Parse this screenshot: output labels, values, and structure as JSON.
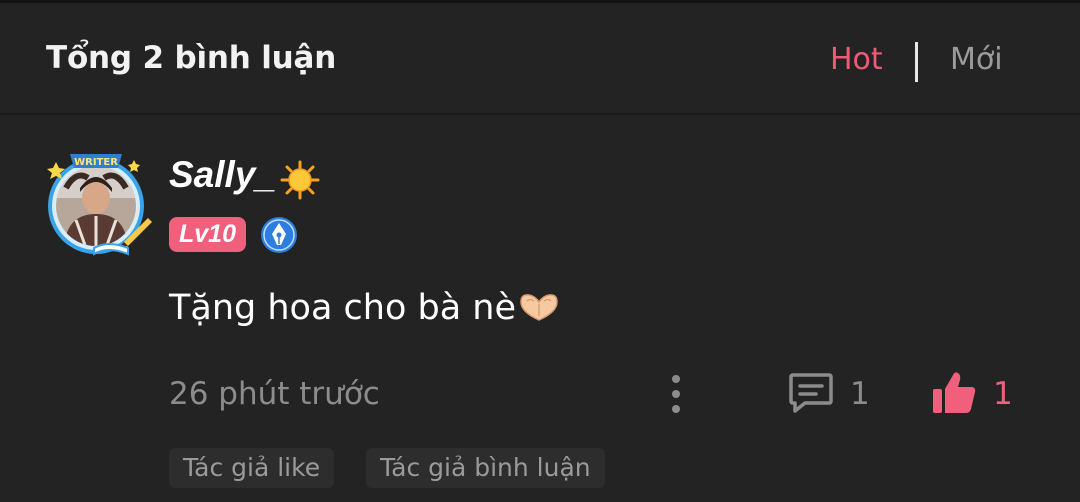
{
  "header": {
    "title": "Tổng 2 bình luận",
    "sort_hot": "Hot",
    "sort_new": "Mới",
    "active_color": "#ef5a76"
  },
  "comment": {
    "avatar_frame_label": "WRITER",
    "username": "Sally_",
    "username_icon": "sun-emoji",
    "level_badge": "Lv10",
    "role_icon": "writer-pen-badge-icon",
    "text": "Tặng hoa cho bà nè",
    "text_emoji": "heart-hands-emoji",
    "time": "26 phút trước",
    "reply_count": "1",
    "like_count": "1",
    "liked": true,
    "tags": [
      "Tác giả like",
      "Tác giả bình luận"
    ]
  }
}
